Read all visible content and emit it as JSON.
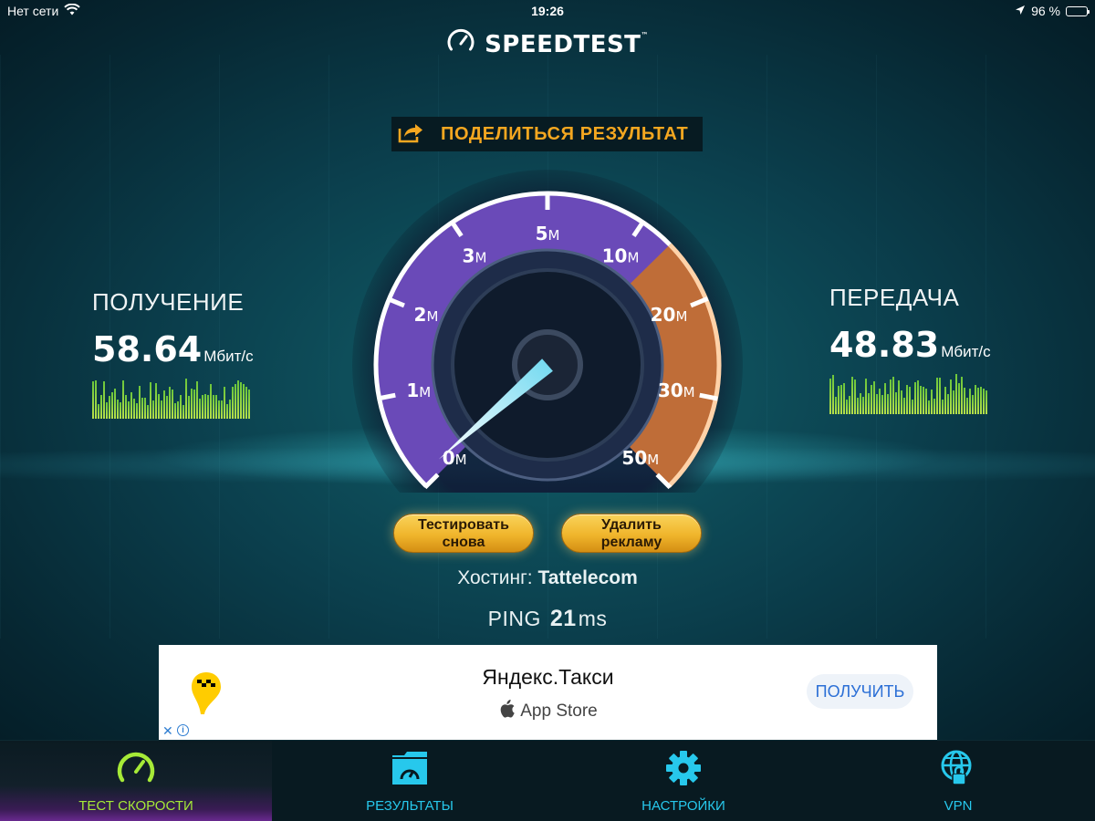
{
  "status": {
    "carrier": "Нет сети",
    "time": "19:26",
    "battery": "96 %",
    "battery_level": 0.96
  },
  "brand": {
    "name": "SPEEDTEST",
    "trademark": "™"
  },
  "share": {
    "label": "ПОДЕЛИТЬСЯ РЕЗУЛЬТАТ"
  },
  "download": {
    "label": "ПОЛУЧЕНИЕ",
    "value": "58.64",
    "unit": "Мбит/с"
  },
  "upload": {
    "label": "ПЕРЕДАЧА",
    "value": "48.83",
    "unit": "Мбит/с"
  },
  "gauge": {
    "ticks": [
      {
        "num": "0",
        "unit": "M"
      },
      {
        "num": "1",
        "unit": "M"
      },
      {
        "num": "2",
        "unit": "M"
      },
      {
        "num": "3",
        "unit": "M"
      },
      {
        "num": "5",
        "unit": "M"
      },
      {
        "num": "10",
        "unit": "M"
      },
      {
        "num": "20",
        "unit": "M"
      },
      {
        "num": "30",
        "unit": "M"
      },
      {
        "num": "50",
        "unit": "M"
      }
    ],
    "needle_value": "0"
  },
  "buttons": {
    "retest": "Тестировать снова",
    "remove_ads": "Удалить рекламу"
  },
  "host": {
    "label": "Хостинг:",
    "value": "Tattelecom"
  },
  "ping": {
    "label": "PING",
    "value": "21",
    "unit": "ms"
  },
  "ad": {
    "title": "Яндекс.Такси",
    "store": "App Store",
    "cta": "ПОЛУЧИТЬ",
    "close": "✕",
    "info": "i"
  },
  "tabs": [
    {
      "label": "ТЕСТ СКОРОСТИ",
      "icon": "speedometer-icon",
      "color": "#a6ea37"
    },
    {
      "label": "РЕЗУЛЬТАТЫ",
      "icon": "folder-gauge-icon",
      "color": "#27c8ec"
    },
    {
      "label": "НАСТРОЙКИ",
      "icon": "gear-icon",
      "color": "#27c8ec"
    },
    {
      "label": "VPN",
      "icon": "globe-lock-icon",
      "color": "#27c8ec"
    }
  ],
  "colors": {
    "accent_orange": "#f4a720",
    "active_green": "#a6ea37",
    "tab_blue": "#27c8ec",
    "gauge_purple": "#6a4ab8",
    "gauge_orange": "#c9712a"
  }
}
